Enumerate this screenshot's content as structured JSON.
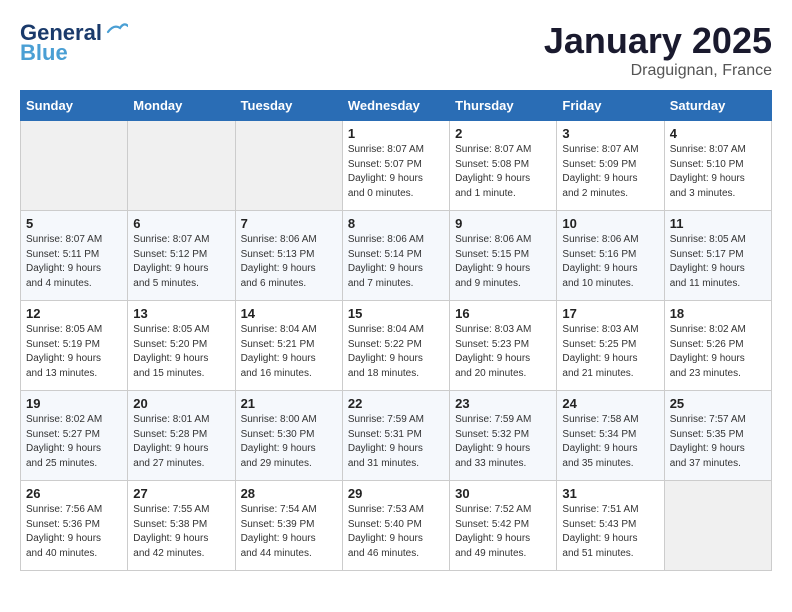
{
  "header": {
    "logo_general": "General",
    "logo_blue": "Blue",
    "month": "January 2025",
    "location": "Draguignan, France"
  },
  "weekdays": [
    "Sunday",
    "Monday",
    "Tuesday",
    "Wednesday",
    "Thursday",
    "Friday",
    "Saturday"
  ],
  "weeks": [
    [
      {
        "day": "",
        "info": ""
      },
      {
        "day": "",
        "info": ""
      },
      {
        "day": "",
        "info": ""
      },
      {
        "day": "1",
        "info": "Sunrise: 8:07 AM\nSunset: 5:07 PM\nDaylight: 9 hours\nand 0 minutes."
      },
      {
        "day": "2",
        "info": "Sunrise: 8:07 AM\nSunset: 5:08 PM\nDaylight: 9 hours\nand 1 minute."
      },
      {
        "day": "3",
        "info": "Sunrise: 8:07 AM\nSunset: 5:09 PM\nDaylight: 9 hours\nand 2 minutes."
      },
      {
        "day": "4",
        "info": "Sunrise: 8:07 AM\nSunset: 5:10 PM\nDaylight: 9 hours\nand 3 minutes."
      }
    ],
    [
      {
        "day": "5",
        "info": "Sunrise: 8:07 AM\nSunset: 5:11 PM\nDaylight: 9 hours\nand 4 minutes."
      },
      {
        "day": "6",
        "info": "Sunrise: 8:07 AM\nSunset: 5:12 PM\nDaylight: 9 hours\nand 5 minutes."
      },
      {
        "day": "7",
        "info": "Sunrise: 8:06 AM\nSunset: 5:13 PM\nDaylight: 9 hours\nand 6 minutes."
      },
      {
        "day": "8",
        "info": "Sunrise: 8:06 AM\nSunset: 5:14 PM\nDaylight: 9 hours\nand 7 minutes."
      },
      {
        "day": "9",
        "info": "Sunrise: 8:06 AM\nSunset: 5:15 PM\nDaylight: 9 hours\nand 9 minutes."
      },
      {
        "day": "10",
        "info": "Sunrise: 8:06 AM\nSunset: 5:16 PM\nDaylight: 9 hours\nand 10 minutes."
      },
      {
        "day": "11",
        "info": "Sunrise: 8:05 AM\nSunset: 5:17 PM\nDaylight: 9 hours\nand 11 minutes."
      }
    ],
    [
      {
        "day": "12",
        "info": "Sunrise: 8:05 AM\nSunset: 5:19 PM\nDaylight: 9 hours\nand 13 minutes."
      },
      {
        "day": "13",
        "info": "Sunrise: 8:05 AM\nSunset: 5:20 PM\nDaylight: 9 hours\nand 15 minutes."
      },
      {
        "day": "14",
        "info": "Sunrise: 8:04 AM\nSunset: 5:21 PM\nDaylight: 9 hours\nand 16 minutes."
      },
      {
        "day": "15",
        "info": "Sunrise: 8:04 AM\nSunset: 5:22 PM\nDaylight: 9 hours\nand 18 minutes."
      },
      {
        "day": "16",
        "info": "Sunrise: 8:03 AM\nSunset: 5:23 PM\nDaylight: 9 hours\nand 20 minutes."
      },
      {
        "day": "17",
        "info": "Sunrise: 8:03 AM\nSunset: 5:25 PM\nDaylight: 9 hours\nand 21 minutes."
      },
      {
        "day": "18",
        "info": "Sunrise: 8:02 AM\nSunset: 5:26 PM\nDaylight: 9 hours\nand 23 minutes."
      }
    ],
    [
      {
        "day": "19",
        "info": "Sunrise: 8:02 AM\nSunset: 5:27 PM\nDaylight: 9 hours\nand 25 minutes."
      },
      {
        "day": "20",
        "info": "Sunrise: 8:01 AM\nSunset: 5:28 PM\nDaylight: 9 hours\nand 27 minutes."
      },
      {
        "day": "21",
        "info": "Sunrise: 8:00 AM\nSunset: 5:30 PM\nDaylight: 9 hours\nand 29 minutes."
      },
      {
        "day": "22",
        "info": "Sunrise: 7:59 AM\nSunset: 5:31 PM\nDaylight: 9 hours\nand 31 minutes."
      },
      {
        "day": "23",
        "info": "Sunrise: 7:59 AM\nSunset: 5:32 PM\nDaylight: 9 hours\nand 33 minutes."
      },
      {
        "day": "24",
        "info": "Sunrise: 7:58 AM\nSunset: 5:34 PM\nDaylight: 9 hours\nand 35 minutes."
      },
      {
        "day": "25",
        "info": "Sunrise: 7:57 AM\nSunset: 5:35 PM\nDaylight: 9 hours\nand 37 minutes."
      }
    ],
    [
      {
        "day": "26",
        "info": "Sunrise: 7:56 AM\nSunset: 5:36 PM\nDaylight: 9 hours\nand 40 minutes."
      },
      {
        "day": "27",
        "info": "Sunrise: 7:55 AM\nSunset: 5:38 PM\nDaylight: 9 hours\nand 42 minutes."
      },
      {
        "day": "28",
        "info": "Sunrise: 7:54 AM\nSunset: 5:39 PM\nDaylight: 9 hours\nand 44 minutes."
      },
      {
        "day": "29",
        "info": "Sunrise: 7:53 AM\nSunset: 5:40 PM\nDaylight: 9 hours\nand 46 minutes."
      },
      {
        "day": "30",
        "info": "Sunrise: 7:52 AM\nSunset: 5:42 PM\nDaylight: 9 hours\nand 49 minutes."
      },
      {
        "day": "31",
        "info": "Sunrise: 7:51 AM\nSunset: 5:43 PM\nDaylight: 9 hours\nand 51 minutes."
      },
      {
        "day": "",
        "info": ""
      }
    ]
  ]
}
